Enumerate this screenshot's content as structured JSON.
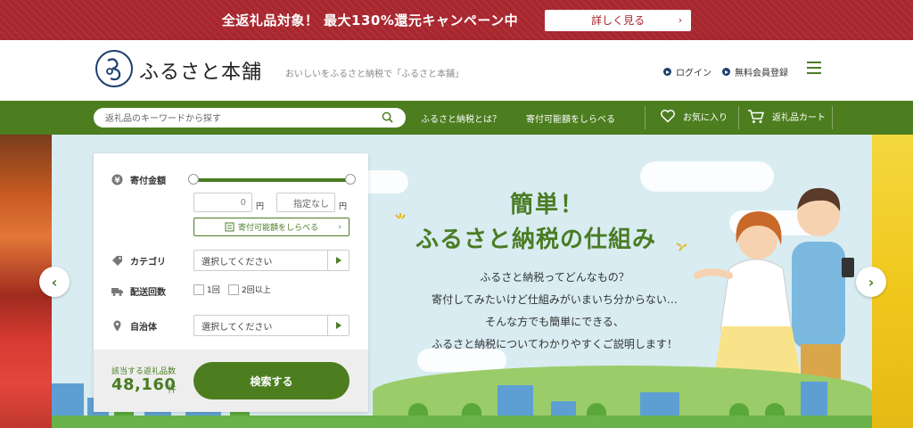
{
  "promo": {
    "text": "全返礼品対象！ 最大130%還元キャンペーン中",
    "button_label": "詳しく見る"
  },
  "header": {
    "logo_text": "ふるさと本舗",
    "tagline": "おいしいをふるさと納税で「ふるさと本舗」",
    "login_label": "ログイン",
    "register_label": "無料会員登録"
  },
  "nav": {
    "search_placeholder": "返礼品のキーワードから探す",
    "links": [
      "ふるさと納税とは？",
      "寄付可能額をしらべる"
    ],
    "favorites_label": "お気に入り",
    "cart_label": "返礼品カート"
  },
  "search_panel": {
    "amount_label": "寄付金額",
    "min_value": "0",
    "max_value": "指定なし",
    "unit": "円",
    "calc_button_label": "寄付可能額をしらべる",
    "category_label": "カテゴリ",
    "category_placeholder": "選択してください",
    "delivery_label": "配送回数",
    "delivery_options": [
      "1回",
      "2回以上"
    ],
    "municipality_label": "自治体",
    "municipality_placeholder": "選択してください",
    "count_label": "該当する返礼品数",
    "count_value": "48,160",
    "count_unit": "件",
    "search_button_label": "検索する"
  },
  "hero": {
    "title_line1": "簡単！",
    "title_line2": "ふるさと納税の仕組み",
    "body_lines": [
      "ふるさと納税ってどんなもの？",
      "寄付してみたいけど仕組みがいまいち分からない…",
      "そんな方でも簡単にできる、",
      "ふるさと納税についてわかりやすくご説明します！"
    ]
  },
  "colors": {
    "promo_red": "#a8262e",
    "brand_green": "#4c7d1f",
    "logo_navy": "#1d3e6e",
    "sky": "#d8ecf1"
  },
  "icons": {
    "search": "search-icon",
    "heart": "heart-icon",
    "cart": "cart-icon",
    "menu": "hamburger-icon",
    "prev": "chevron-left-icon",
    "next": "chevron-right-icon"
  }
}
